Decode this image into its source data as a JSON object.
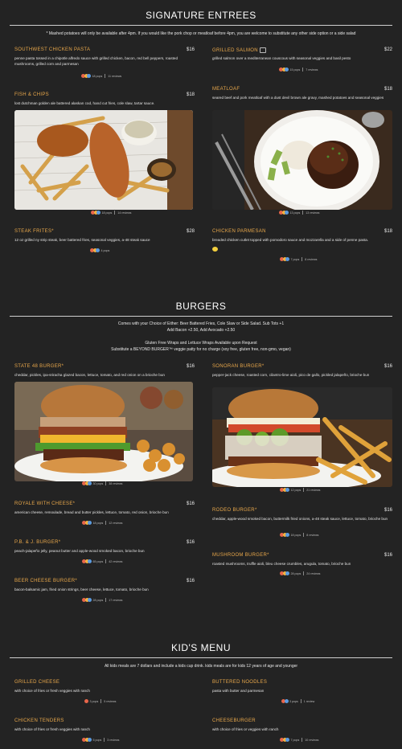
{
  "colors": {
    "background": "#232323",
    "accent": "#e9a84b",
    "text": "#e2e2e2"
  },
  "signature": {
    "title": "SIGNATURE ENTREES",
    "note": "* Mashed potatoes will only be available after 4pm. If you would like the pork chop or meatloaf before 4pm, you are welcome to substitute any other side option or a side salad",
    "items": [
      {
        "name": "SOUTHWEST CHICKEN PASTA",
        "price": "$16",
        "desc": "penne pasta tossed in a chipotle alfredo sauce with grilled chicken, bacon, red bell peppers, roasted mushrooms, grilled corn and parmesan",
        "pops": "18 pops",
        "reviews": "11 reviews"
      },
      {
        "name": "GRILLED SALMON",
        "price": "$22",
        "desc": "grilled salmon over a mediterranean couscous with seasonal veggies and basil pesto",
        "pops": "15 pops",
        "reviews": "7 reviews"
      },
      {
        "name": "FISH & CHIPS",
        "price": "$18",
        "desc": "lost dutchman golden ale battered alaskan cod, hand cut fries, cole slaw, tartar sauce.",
        "pops": "18 pops",
        "reviews": "14 reviews"
      },
      {
        "name": "MEATLOAF",
        "price": "$18",
        "desc": "seared beef and pork meatloaf with a dust devil brown ale gravy, mashed potatoes and seasonal veggies",
        "pops": "13 pops",
        "reviews": "13 reviews"
      },
      {
        "name": "STEAK FRITES*",
        "price": "$28",
        "desc": "12 oz grilled ny strip steak, beer battered fries, seasonal veggies, a-48 steak sauce",
        "pops": "4 pops",
        "reviews": ""
      },
      {
        "name": "CHICKEN PARMESAN",
        "price": "$18",
        "desc": "breaded chicken cutlet topped with pomodoro sauce and mozzarella and a side of penne pasta.",
        "pops": "7 pops",
        "reviews": "8 reviews"
      }
    ]
  },
  "burgers": {
    "title": "BURGERS",
    "note1": "Comes with your Choice of Either: Beer Battered Fries, Cole Slaw or Side Salad. Sub Tots +1",
    "note2": "Add Bacon +2.50, Add Avocado +2.50",
    "note3": "Gluten Free Wraps and Lettuce Wraps Available upon Request",
    "note4": "Substitute a BEYOND BURGER™ veggie patty for no charge (soy free, gluten free, non-gmo, vegan)",
    "items": [
      {
        "name": "STATE 48 BURGER*",
        "price": "$16",
        "desc": "cheddar, pickles, ipa-sriracha glazed bacon, lettuce, tomato, and red onion on a brioche bun",
        "pops": "30 pops",
        "reviews": "38 reviews"
      },
      {
        "name": "SONORAN BURGER*",
        "price": "$16",
        "desc": "pepper-jack cheese, roasted corn, cilantro-lime aioli, pico de gallo, pickled jalapeño, brioche bun",
        "pops": "12 pops",
        "reviews": "21 reviews"
      },
      {
        "name": "ROYALE WITH CHEESE*",
        "price": "$16",
        "desc": "american cheese, remoulade, bread and butter pickles, lettuce, tomato, red onion, brioche bun",
        "pops": "18 pops",
        "reviews": "12 reviews"
      },
      {
        "name": "RODEO BURGER*",
        "price": "$16",
        "desc": "cheddar, apple-wood smoked bacon, buttermilk fried onions, a-48 steak sauce, lettuce, tomato, brioche bun",
        "pops": "18 pops",
        "reviews": "8 reviews"
      },
      {
        "name": "P.B. & J. BURGER*",
        "price": "$16",
        "desc": "peach-jalapeño jelly, peanut butter and apple-wood smoked bacon, brioche bun",
        "pops": "65 pops",
        "reviews": "42 reviews"
      },
      {
        "name": "MUSHROOM BURGER*",
        "price": "$16",
        "desc": "roasted mushrooms, truffle aioli, bleu cheese crumbles, arugula, tomato, brioche bun",
        "pops": "28 pops",
        "reviews": "24 reviews"
      },
      {
        "name": "BEER CHEESE BURGER*",
        "price": "$16",
        "desc": "bacon-balsamic jam, fried onion strings, beer cheese, lettuce, tomato, brioche bun",
        "pops": "28 pops",
        "reviews": "17 reviews"
      }
    ]
  },
  "kids": {
    "title": "KID'S MENU",
    "note": "All kids meals are 7 dollars and include a kids cup drink. kids meals are for kids 12 years of age and younger",
    "items": [
      {
        "name": "GRILLED CHEESE",
        "desc": "with choice of fries or fresh veggies with ranch",
        "pops": "3 pops",
        "reviews": "5 reviews"
      },
      {
        "name": "BUTTERED NOODLES",
        "desc": "pasta with butter and parmesan",
        "pops": "3 pops",
        "reviews": "1 review"
      },
      {
        "name": "CHICKEN TENDERS",
        "desc": "with choice of fries or fresh veggies with ranch",
        "pops": "5 pops",
        "reviews": "3 reviews"
      },
      {
        "name": "CHEESEBURGER",
        "desc": "with choice of fries or veggies with ranch",
        "pops": "7 pops",
        "reviews": "10 reviews"
      }
    ]
  }
}
